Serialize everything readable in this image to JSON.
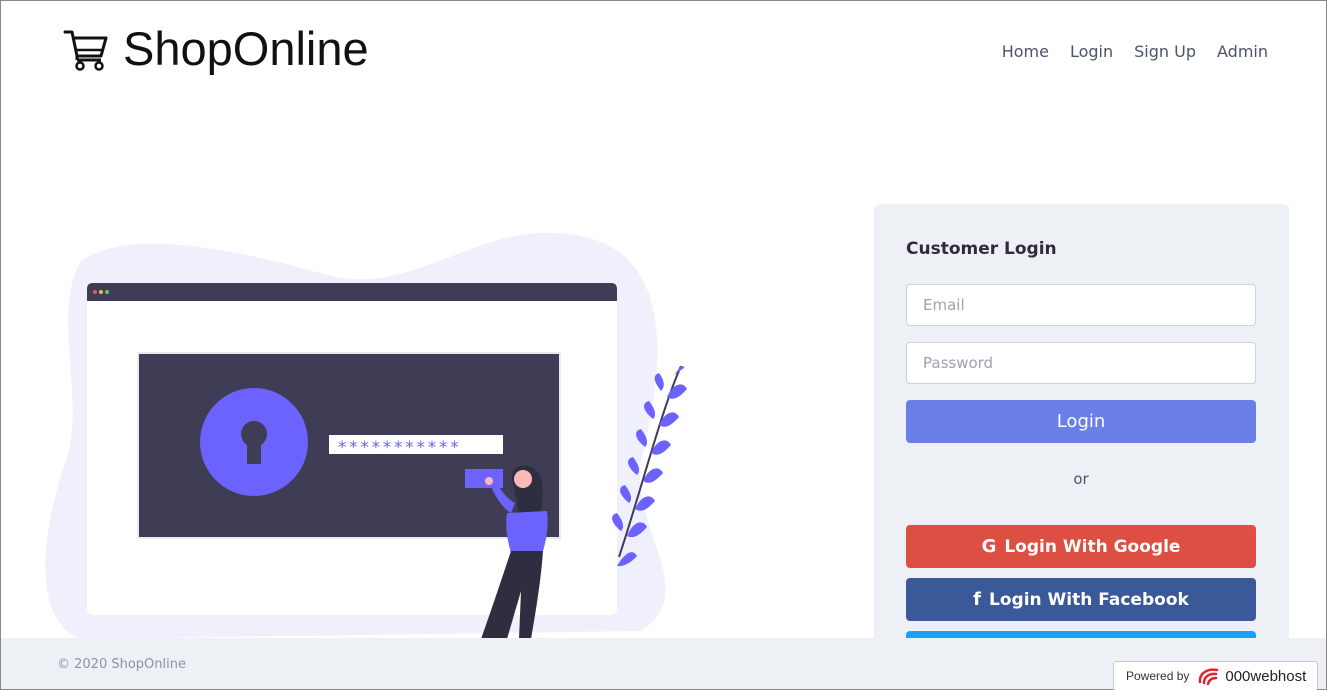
{
  "brand": {
    "name": "ShopOnline",
    "icon": "shopping-cart-icon"
  },
  "nav": {
    "items": [
      {
        "label": "Home"
      },
      {
        "label": "Login"
      },
      {
        "label": "Sign Up"
      },
      {
        "label": "Admin"
      }
    ]
  },
  "illustration": {
    "password_mask": "***********",
    "colors": {
      "accent": "#6c63ff",
      "dark": "#3f3d56",
      "blob": "#f0effc"
    }
  },
  "login_card": {
    "title": "Customer Login",
    "email_placeholder": "Email",
    "password_placeholder": "Password",
    "login_label": "Login",
    "or_label": "or",
    "google_label": "Login With Google",
    "google_icon": "G",
    "facebook_label": "Login With Facebook",
    "facebook_icon": "f",
    "colors": {
      "login": "#6b7fe8",
      "google": "#dd4f43",
      "facebook": "#3b5998",
      "twitter": "#1da1f2"
    }
  },
  "footer": {
    "copyright": "© 2020 ShopOnline",
    "powered_by_label": "Powered by",
    "powered_by_name": "000webhost"
  }
}
